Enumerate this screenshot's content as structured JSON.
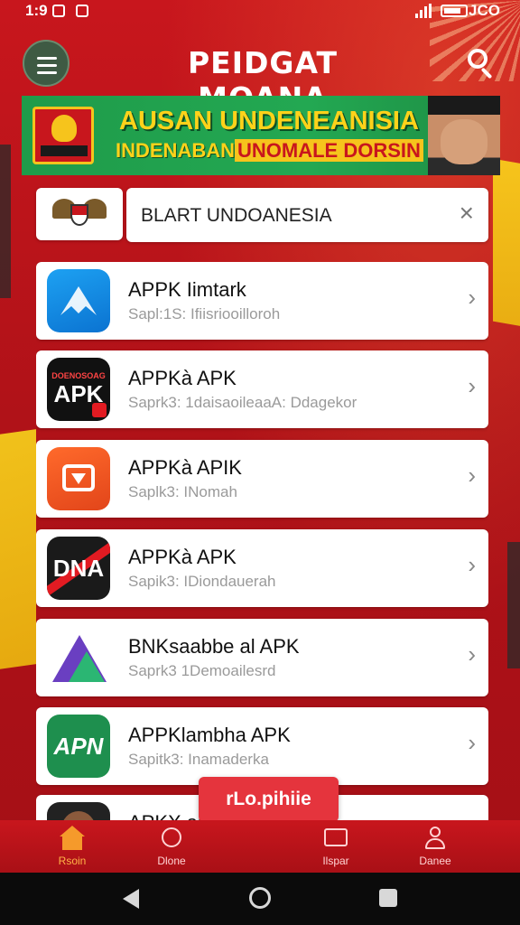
{
  "status_bar": {
    "time": "1:9",
    "right_text": "JCO"
  },
  "header": {
    "title": "PEIDGAT MOANA"
  },
  "banner": {
    "line1": "AUSAN UNDENEANISIA",
    "line2_prefix": "INDENABAN",
    "line2_highlight": "UNOMALE DORSIN"
  },
  "search": {
    "value": "BLART UNDOANESIA",
    "clear_icon": "×"
  },
  "apps": [
    {
      "title": "APPK Iimtark",
      "subtitle": "Sapl:1S: Ifiisriooilloroh",
      "icon_text": ""
    },
    {
      "title": "APPKà APK",
      "subtitle": "Saprk3: 1daisaoileaaA: Ddagekor",
      "icon_text": "APK",
      "icon_small": "DOENOSOAG"
    },
    {
      "title": "APPKà APIK",
      "subtitle": "Saplk3: INomah",
      "icon_text": ""
    },
    {
      "title": "APPKà APK",
      "subtitle": "Sapik3: IDiondauerah",
      "icon_text": "DNA"
    },
    {
      "title": "BNKsaabbe al APK",
      "subtitle": "Saprk3 1Demoailesrd",
      "icon_text": ""
    },
    {
      "title": "APPKlambha APK",
      "subtitle": "Sapitk3: Inamaderka",
      "icon_text": "APN"
    },
    {
      "title": "APKX al",
      "subtitle": "",
      "icon_text": ""
    }
  ],
  "chevron": "›",
  "floating_button": {
    "label": "rLo.pihiie"
  },
  "bottom_nav": [
    {
      "label": "Rsoin",
      "icon": "home-icon"
    },
    {
      "label": "Dlone",
      "icon": "globe-icon"
    },
    {
      "label": "Ilspar",
      "icon": "tv-icon"
    },
    {
      "label": "Danee",
      "icon": "user-icon"
    }
  ],
  "colors": {
    "primary_red": "#c8161d",
    "banner_green": "#1f9b4a",
    "banner_text_yellow": "#ffd21a",
    "nav_active": "#f59a2b",
    "pill_red": "#e5343d"
  }
}
